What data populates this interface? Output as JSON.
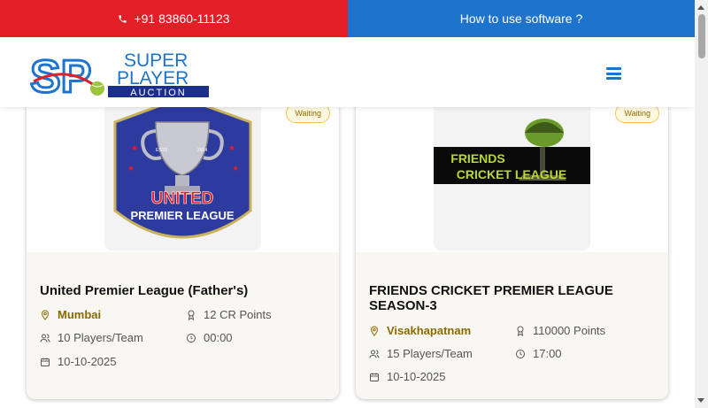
{
  "topbar": {
    "phone": "+91 83860-11123",
    "howto": "How to use software ?"
  },
  "brand": {
    "logo_line1": "SUPER",
    "logo_line2": "PLAYER",
    "logo_line3": "AUCTION",
    "logo_initials": "SP"
  },
  "colors": {
    "red": "#e21e26",
    "blue": "#1e73cc",
    "gold": "#8a6a00"
  },
  "cards": [
    {
      "status": "Waiting",
      "logo_text_1": "UNITED",
      "logo_text_2": "PREMIER LEAGUE",
      "logo_estd": "ESTD",
      "logo_year": "2024",
      "title": "United Premier League (Father's)",
      "location": "Mumbai",
      "points": "12 CR Points",
      "players": "10 Players/Team",
      "time": "00:00",
      "date": "10-10-2025"
    },
    {
      "status": "Waiting",
      "logo_text_1": "FRIENDS",
      "logo_text_2": "CRICKET LEAGUE",
      "title": "FRIENDS CRICKET PREMIER LEAGUE SEASON-3",
      "location": "Visakhapatnam",
      "points": "110000 Points",
      "players": "15 Players/Team",
      "time": "17:00",
      "date": "10-10-2025"
    }
  ]
}
